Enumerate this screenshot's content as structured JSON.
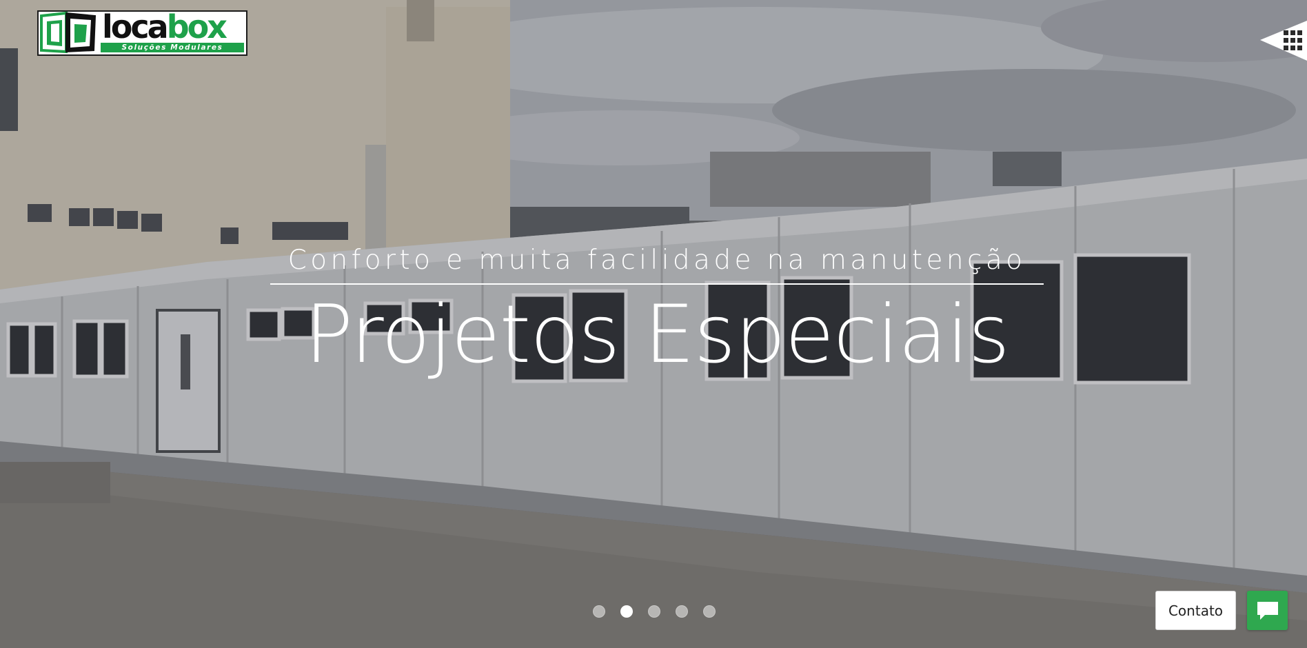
{
  "brand": {
    "name_left": "loca",
    "name_right": "box",
    "tagline": "Soluções Modulares"
  },
  "colors": {
    "brand_green": "#1ea14a",
    "chat_green": "#2fa84f",
    "text_white": "#ffffff"
  },
  "hero": {
    "subtitle": "Conforto e muita facilidade na manutenção",
    "title": "Projetos Especiais",
    "slides": 5,
    "active_slide": 2
  },
  "menu": {
    "icon": "grid-icon"
  },
  "contact": {
    "label": "Contato",
    "chat_icon": "chat-bubble-icon"
  }
}
